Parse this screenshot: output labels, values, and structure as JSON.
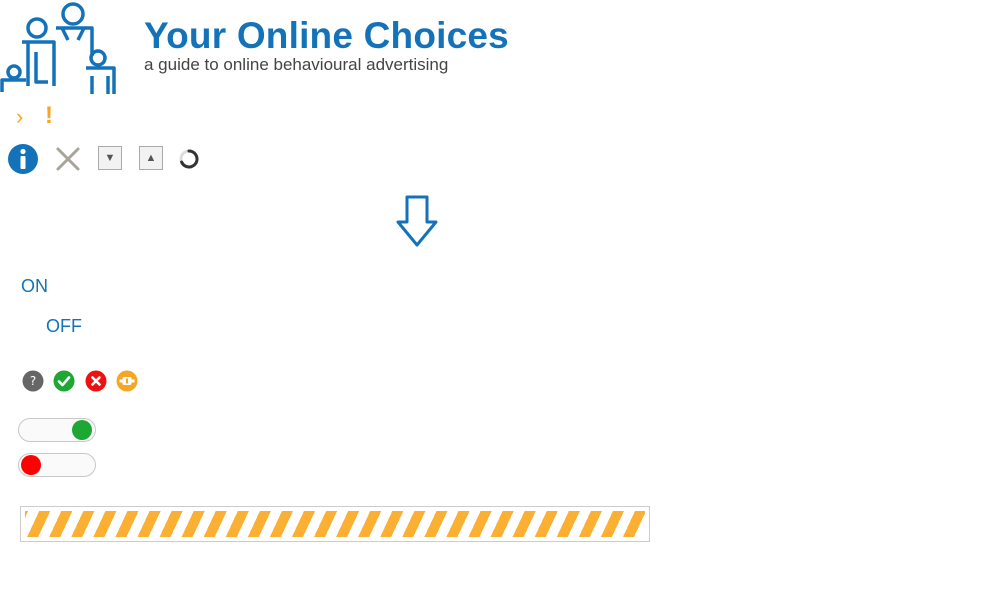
{
  "header": {
    "title": "Your Online Choices",
    "subtitle": "a guide to online behavioural advertising",
    "logo_icon": "family-people-icon"
  },
  "markers": {
    "chevron": "›",
    "exclamation": "!"
  },
  "icons": {
    "info": "info-icon",
    "close": "close-icon",
    "scroll_down": "▼",
    "scroll_up": "▲",
    "loading": "spinner-icon",
    "big_arrow": "down-arrow-icon"
  },
  "labels": {
    "on": "ON",
    "off": "OFF"
  },
  "status_icons": [
    "question-icon",
    "check-icon",
    "cross-icon",
    "plug-icon"
  ],
  "toggles": [
    {
      "state": "on",
      "color": "#1ea734"
    },
    {
      "state": "off",
      "color": "#ff0000"
    }
  ],
  "progress": {
    "state": "loading",
    "color": "#fbb034"
  },
  "colors": {
    "brand": "#1473b8",
    "accent": "#f5a623",
    "success": "#1ea734",
    "error": "#ff0000"
  }
}
